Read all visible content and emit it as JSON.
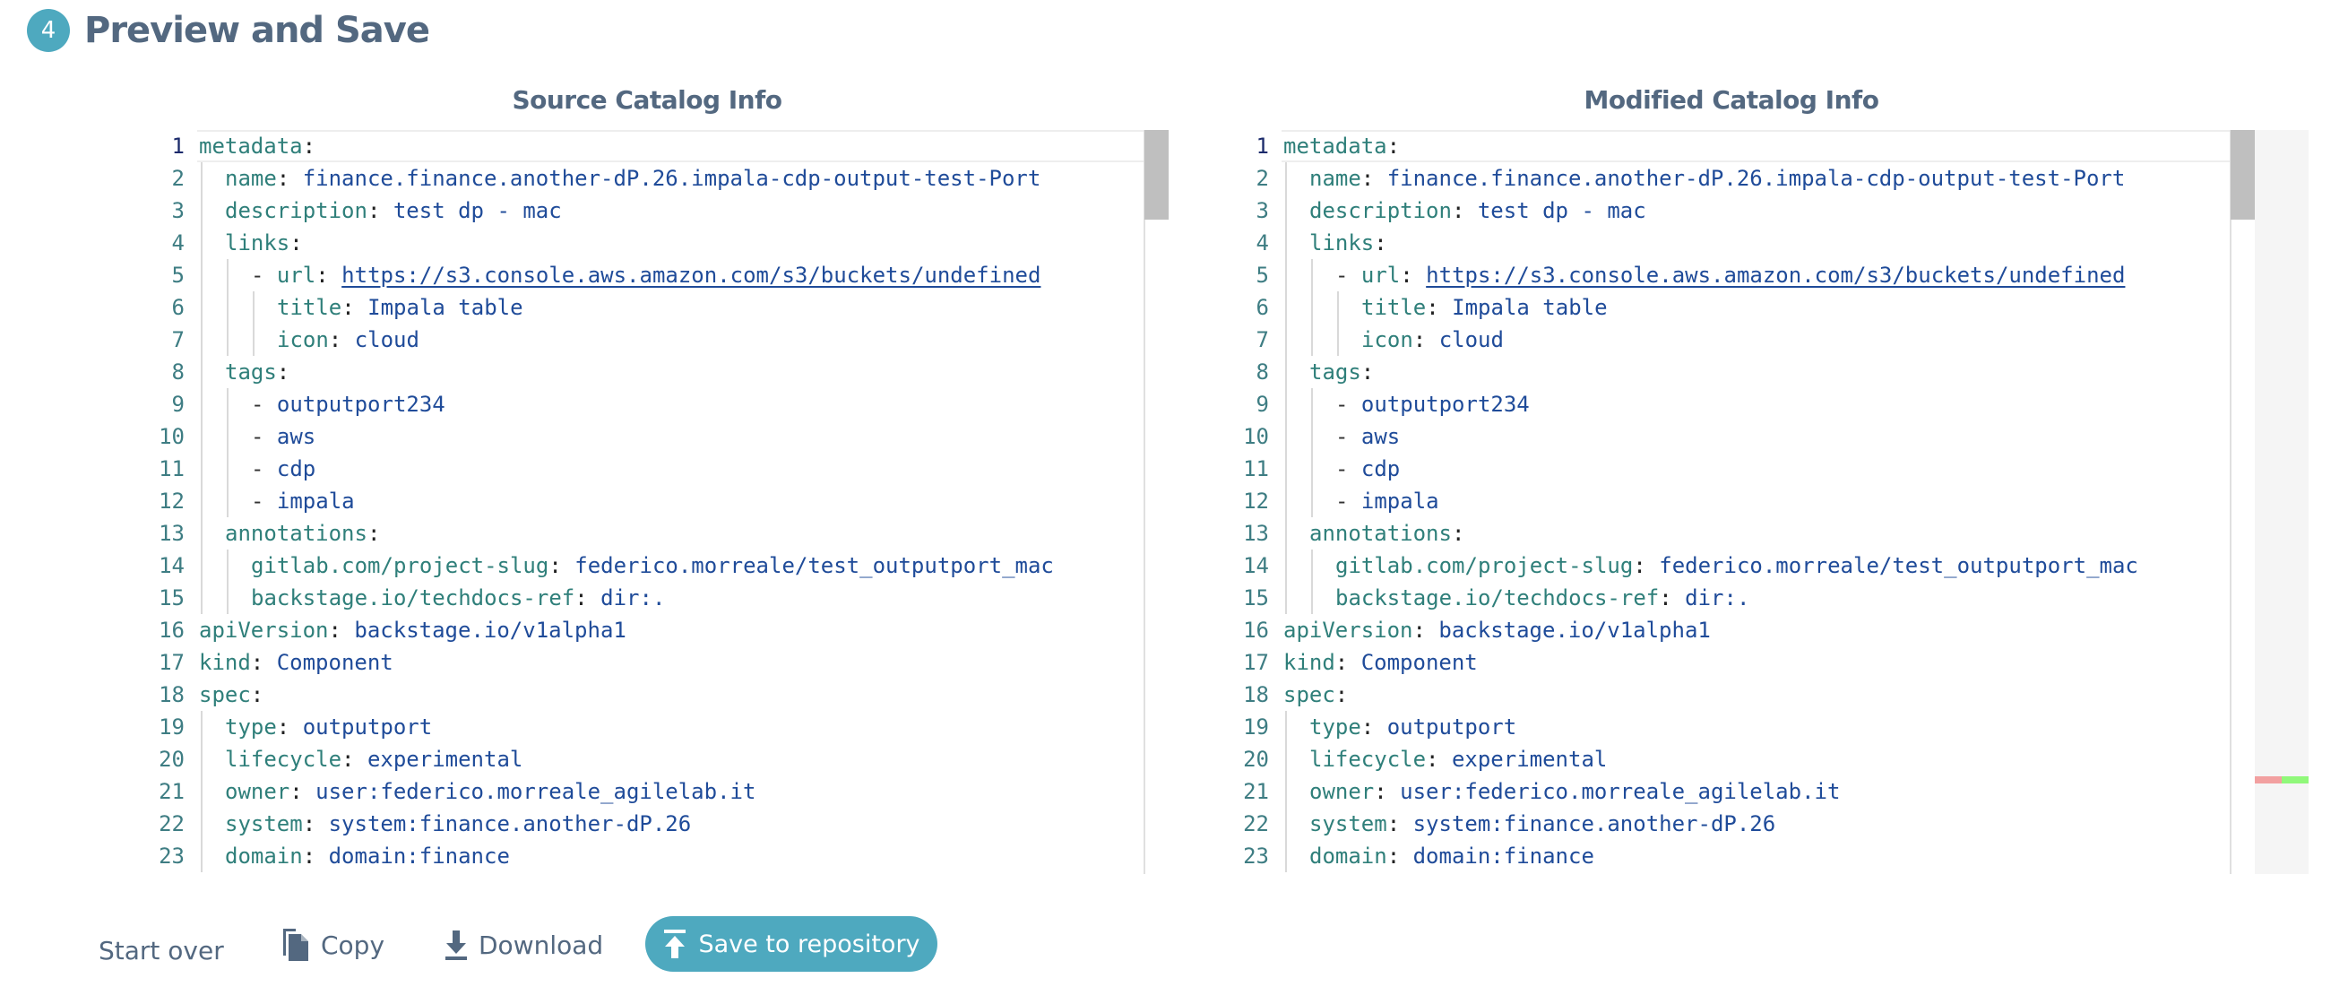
{
  "step": {
    "number": "4",
    "title": "Preview and Save"
  },
  "source": {
    "title": "Source Catalog Info",
    "lines": [
      {
        "n": "1",
        "indent": 0,
        "key": "metadata",
        "value": ""
      },
      {
        "n": "2",
        "indent": 1,
        "key": "name",
        "value": "finance.finance.another-dP.26.impala-cdp-output-test-Port"
      },
      {
        "n": "3",
        "indent": 1,
        "key": "description",
        "value": "test dp - mac"
      },
      {
        "n": "4",
        "indent": 1,
        "key": "links",
        "value": ""
      },
      {
        "n": "5",
        "indent": 2,
        "dash": true,
        "key": "url",
        "value": "https://s3.console.aws.amazon.com/s3/buckets/undefined",
        "link": true
      },
      {
        "n": "6",
        "indent": 3,
        "key": "title",
        "value": "Impala table"
      },
      {
        "n": "7",
        "indent": 3,
        "key": "icon",
        "value": "cloud"
      },
      {
        "n": "8",
        "indent": 1,
        "key": "tags",
        "value": ""
      },
      {
        "n": "9",
        "indent": 2,
        "dash": true,
        "key": "",
        "value": "outputport234"
      },
      {
        "n": "10",
        "indent": 2,
        "dash": true,
        "key": "",
        "value": "aws"
      },
      {
        "n": "11",
        "indent": 2,
        "dash": true,
        "key": "",
        "value": "cdp"
      },
      {
        "n": "12",
        "indent": 2,
        "dash": true,
        "key": "",
        "value": "impala"
      },
      {
        "n": "13",
        "indent": 1,
        "key": "annotations",
        "value": ""
      },
      {
        "n": "14",
        "indent": 2,
        "key": "gitlab.com/project-slug",
        "value": "federico.morreale/test_outputport_mac"
      },
      {
        "n": "15",
        "indent": 2,
        "key": "backstage.io/techdocs-ref",
        "value": "dir:."
      },
      {
        "n": "16",
        "indent": 0,
        "key": "apiVersion",
        "value": "backstage.io/v1alpha1"
      },
      {
        "n": "17",
        "indent": 0,
        "key": "kind",
        "value": "Component"
      },
      {
        "n": "18",
        "indent": 0,
        "key": "spec",
        "value": ""
      },
      {
        "n": "19",
        "indent": 1,
        "key": "type",
        "value": "outputport"
      },
      {
        "n": "20",
        "indent": 1,
        "key": "lifecycle",
        "value": "experimental"
      },
      {
        "n": "21",
        "indent": 1,
        "key": "owner",
        "value": "user:federico.morreale_agilelab.it"
      },
      {
        "n": "22",
        "indent": 1,
        "key": "system",
        "value": "system:finance.another-dP.26"
      },
      {
        "n": "23",
        "indent": 1,
        "key": "domain",
        "value": "domain:finance"
      }
    ]
  },
  "modified": {
    "title": "Modified Catalog Info",
    "lines": [
      {
        "n": "1",
        "indent": 0,
        "key": "metadata",
        "value": ""
      },
      {
        "n": "2",
        "indent": 1,
        "key": "name",
        "value": "finance.finance.another-dP.26.impala-cdp-output-test-Port"
      },
      {
        "n": "3",
        "indent": 1,
        "key": "description",
        "value": "test dp - mac"
      },
      {
        "n": "4",
        "indent": 1,
        "key": "links",
        "value": ""
      },
      {
        "n": "5",
        "indent": 2,
        "dash": true,
        "key": "url",
        "value": "https://s3.console.aws.amazon.com/s3/buckets/undefined",
        "link": true
      },
      {
        "n": "6",
        "indent": 3,
        "key": "title",
        "value": "Impala table"
      },
      {
        "n": "7",
        "indent": 3,
        "key": "icon",
        "value": "cloud"
      },
      {
        "n": "8",
        "indent": 1,
        "key": "tags",
        "value": ""
      },
      {
        "n": "9",
        "indent": 2,
        "dash": true,
        "key": "",
        "value": "outputport234"
      },
      {
        "n": "10",
        "indent": 2,
        "dash": true,
        "key": "",
        "value": "aws"
      },
      {
        "n": "11",
        "indent": 2,
        "dash": true,
        "key": "",
        "value": "cdp"
      },
      {
        "n": "12",
        "indent": 2,
        "dash": true,
        "key": "",
        "value": "impala"
      },
      {
        "n": "13",
        "indent": 1,
        "key": "annotations",
        "value": ""
      },
      {
        "n": "14",
        "indent": 2,
        "key": "gitlab.com/project-slug",
        "value": "federico.morreale/test_outputport_mac"
      },
      {
        "n": "15",
        "indent": 2,
        "key": "backstage.io/techdocs-ref",
        "value": "dir:."
      },
      {
        "n": "16",
        "indent": 0,
        "key": "apiVersion",
        "value": "backstage.io/v1alpha1"
      },
      {
        "n": "17",
        "indent": 0,
        "key": "kind",
        "value": "Component"
      },
      {
        "n": "18",
        "indent": 0,
        "key": "spec",
        "value": ""
      },
      {
        "n": "19",
        "indent": 1,
        "key": "type",
        "value": "outputport"
      },
      {
        "n": "20",
        "indent": 1,
        "key": "lifecycle",
        "value": "experimental"
      },
      {
        "n": "21",
        "indent": 1,
        "key": "owner",
        "value": "user:federico.morreale_agilelab.it"
      },
      {
        "n": "22",
        "indent": 1,
        "key": "system",
        "value": "system:finance.another-dP.26"
      },
      {
        "n": "23",
        "indent": 1,
        "key": "domain",
        "value": "domain:finance"
      }
    ]
  },
  "diff_overview": {
    "changed_line": "21",
    "deleted_color": "#f2a0a0",
    "added_color": "#90f87a"
  },
  "actions": {
    "start_over": "Start over",
    "copy": "Copy",
    "download": "Download",
    "save": "Save to repository"
  },
  "icons": {
    "copy": "copy-icon",
    "download": "download-icon",
    "save": "upload-icon"
  },
  "colors": {
    "accent": "#4ea9bf",
    "heading": "#536880",
    "key": "#2f7f7a",
    "value": "#1f4b99"
  }
}
